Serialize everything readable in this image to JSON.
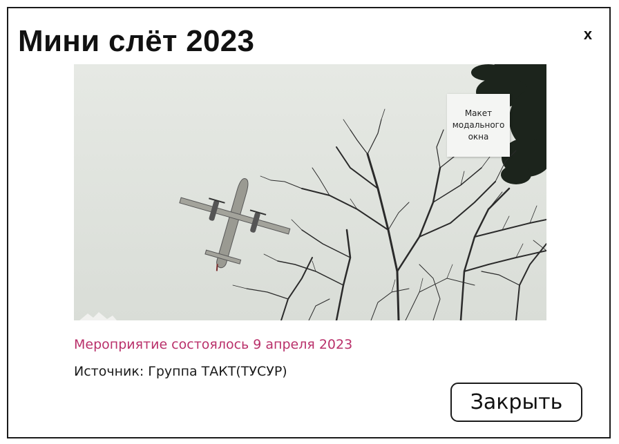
{
  "modal": {
    "title": "Мини слёт 2023",
    "close_icon_label": "x",
    "photo_note": "Макет модального окна",
    "event_date_text": "Мероприятие состоялось 9 апреля 2023",
    "source_text": "Источник: Группа ТАКТ(ТУСУР)",
    "close_button_label": "Закрыть"
  },
  "photo": {
    "subject": "airplane flying over bare trees",
    "sky_color": "#e0e4de",
    "branch_color": "#2a2a2a",
    "pine_color": "#1c241c"
  },
  "colors": {
    "accent": "#b9306a",
    "border": "#1a1a1a",
    "text": "#111111"
  }
}
